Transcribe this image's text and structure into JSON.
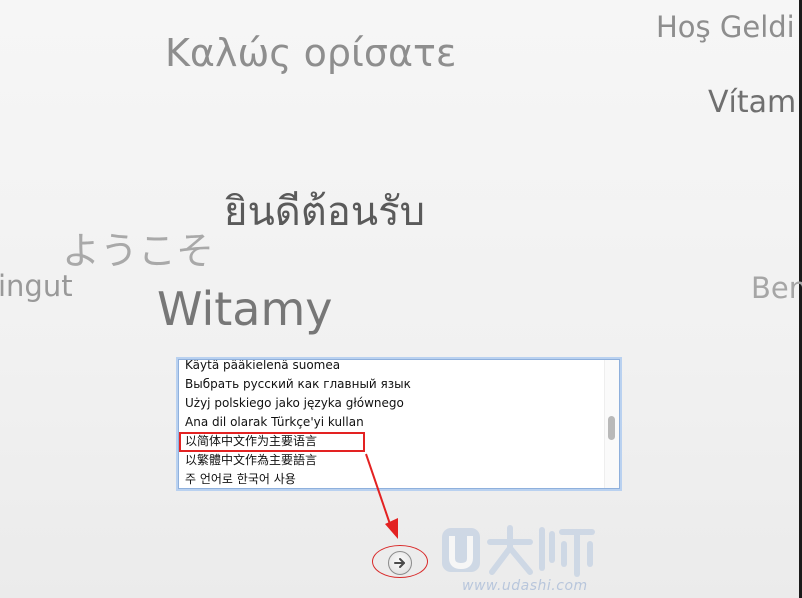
{
  "welcome_words": {
    "greek": "Καλώς ορίσατε",
    "turkish": "Hoş Geldi",
    "czech": "Vítam",
    "thai": "ยินดีต้อนรับ",
    "japanese": "ようこそ",
    "partial_left": "ingut",
    "polish": "Witamy",
    "partial_right": "Ben"
  },
  "language_list": {
    "items": [
      "Käytä pääkielenä suomea",
      "Выбрать русский как главный язык",
      "Użyj polskiego jako języka głównego",
      "Ana dil olarak Türkçe'yi kullan",
      "以简体中文作为主要语言",
      "以繁體中文作為主要語言",
      "주 언어로 한국어 사용"
    ]
  },
  "next_button": {
    "icon": "arrow-right-icon"
  },
  "watermark": {
    "url": "www.udashi.com"
  },
  "colors": {
    "annotation": "#e32222",
    "list_border": "#8fb0dc"
  }
}
